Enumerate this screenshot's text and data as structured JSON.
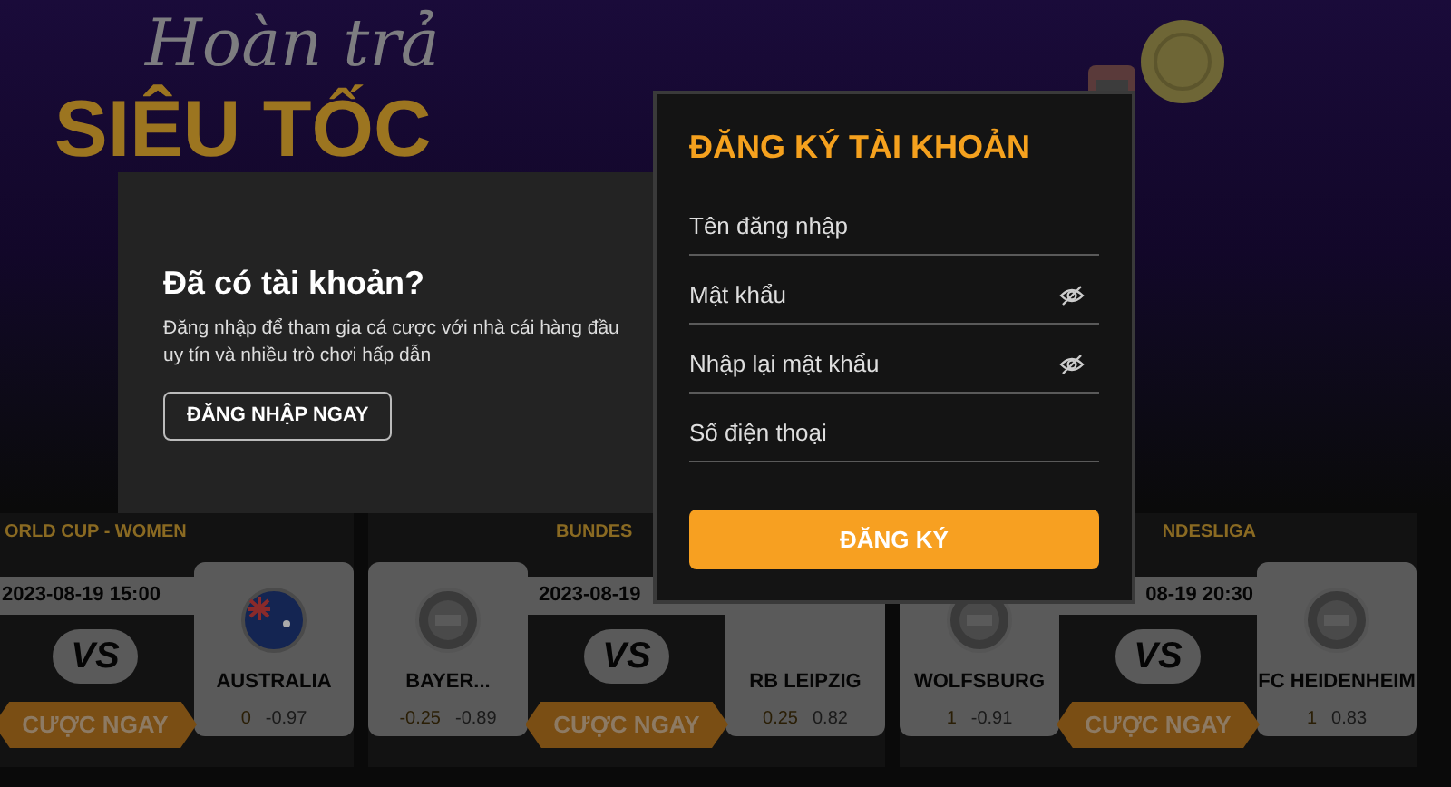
{
  "banner": {
    "script_text": "Hoàn trả",
    "headline": "SIÊU TỐC"
  },
  "matches": [
    {
      "league": "ORLD CUP - WOMEN",
      "time": "2023-08-19 15:00",
      "vs": "VS",
      "bet_button": "CƯỢC NGAY",
      "away": {
        "name": "AUSTRALIA",
        "handicap": "0",
        "odds": "-0.97",
        "kind": "flag"
      }
    },
    {
      "league": "BUNDES",
      "time": "2023-08-19",
      "vs": "VS",
      "bet_button": "CƯỢC NGAY",
      "home": {
        "name": "BAYER...",
        "handicap": "-0.25",
        "odds": "-0.89",
        "kind": "crest"
      },
      "away": {
        "name": "RB LEIPZIG",
        "handicap": "0.25",
        "odds": "0.82",
        "kind": "hidden"
      }
    },
    {
      "league": "NDESLIGA",
      "time": "08-19 20:30",
      "vs": "VS",
      "bet_button": "CƯỢC NGAY",
      "home": {
        "name": "WOLFSBURG",
        "handicap": "1",
        "odds": "-0.91",
        "kind": "crest"
      },
      "away": {
        "name": "FC HEIDENHEIM",
        "handicap": "1",
        "odds": "0.83",
        "kind": "crest"
      }
    }
  ],
  "login_panel": {
    "title": "Đã có tài khoản?",
    "description": "Đăng nhập để tham gia cá cược với nhà cái hàng đầu uy tín và nhiều trò chơi hấp dẫn",
    "button": "ĐĂNG NHẬP NGAY"
  },
  "register_panel": {
    "title": "ĐĂNG KÝ TÀI KHOẢN",
    "fields": [
      {
        "placeholder": "Tên đăng nhập",
        "kind": "text"
      },
      {
        "placeholder": "Mật khẩu",
        "kind": "password"
      },
      {
        "placeholder": "Nhập lại mật khẩu",
        "kind": "password"
      },
      {
        "placeholder": "Số điện thoại",
        "kind": "text"
      }
    ],
    "submit": "ĐĂNG KÝ"
  }
}
